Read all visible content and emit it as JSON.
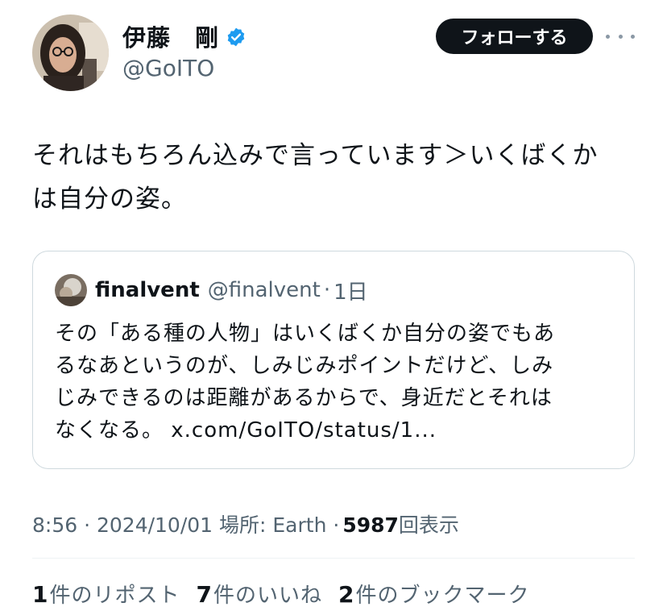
{
  "author": {
    "name": "伊藤　剛",
    "handle": "@GoITO",
    "verified": true
  },
  "follow_button": {
    "label": "フォローする"
  },
  "tweet": {
    "text": "それはもちろん込みで言っています＞いくばくか\nは自分の姿。"
  },
  "quote": {
    "name": "finalvent",
    "handle": "@finalvent",
    "separator": "·",
    "time": "1日",
    "text": "その「ある種の人物」はいくばくか自分の姿でもあ\nるなあというのが、しみじみポイントだけど、しみ\nじみできるのは距離があるからで、身近だとそれは\nなくなる。 x.com/GoITO/status/1..."
  },
  "meta": {
    "time_date_location": "8:56 · 2024/10/01 場所: Earth ·",
    "views_count": "5987",
    "views_label": "回表示"
  },
  "stats": {
    "reposts": {
      "count": "1",
      "label": "件のリポスト"
    },
    "likes": {
      "count": "7",
      "label": "件のいいね"
    },
    "bookmarks": {
      "count": "2",
      "label": "件のブックマーク"
    }
  },
  "colors": {
    "primary_text": "#0f1419",
    "secondary_text": "#536471",
    "verified_blue": "#1d9bf0",
    "border": "#cfd9de"
  }
}
